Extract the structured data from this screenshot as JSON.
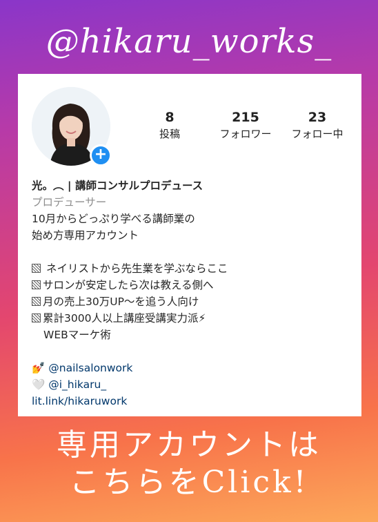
{
  "header": {
    "handle": "@hikaru_works_"
  },
  "profile": {
    "stats": [
      {
        "value": "8",
        "label": "投稿"
      },
      {
        "value": "215",
        "label": "フォロワー"
      },
      {
        "value": "23",
        "label": "フォロー中"
      }
    ],
    "name": "光。︵ | 講師コンサルプロデュース",
    "category": "プロデューサー",
    "bio_lines": [
      "10月からどっぷり学べる講師業の",
      "始め方専用アカウント"
    ],
    "bullets": [
      "ネイリストから先生業を学ぶならここ",
      "サロンが安定したら次は教える側へ",
      "月の売上30万UP〜を追う人向け",
      "累計3000人以上講座受講実力派⚡"
    ],
    "bullet_cont": "WEBマーケ術",
    "mention1": {
      "emoji": "💅",
      "handle": "@nailsalonwork"
    },
    "mention2": {
      "emoji": "🤍",
      "handle": "@i_hikaru_"
    },
    "link": "lit.link/hikaruwork"
  },
  "cta": {
    "line1": "専用アカウントは",
    "line2": "こちらをClick!"
  }
}
